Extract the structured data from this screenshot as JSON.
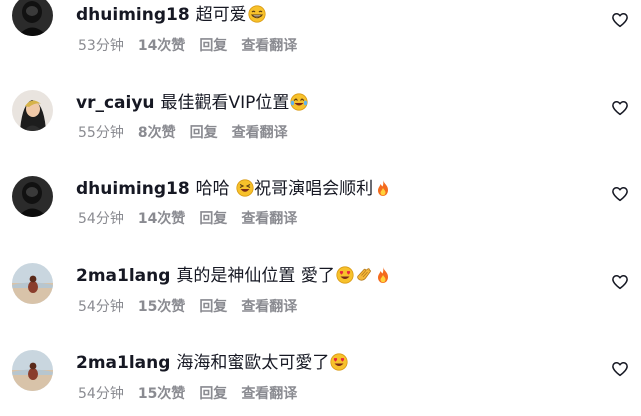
{
  "comments": [
    {
      "username": "dhuiming18",
      "text": "超可爱",
      "emojis": [
        "grin-emoji"
      ],
      "time": "53分钟",
      "likes": "14次赞",
      "reply": "回复",
      "translate": "查看翻译",
      "avatar": "dark-avatar"
    },
    {
      "username": "vr_caiyu",
      "text": "最佳觀看VIP位置",
      "emojis": [
        "laugh-tears-emoji"
      ],
      "time": "55分钟",
      "likes": "8次赞",
      "reply": "回复",
      "translate": "查看翻译",
      "avatar": "girl-avatar"
    },
    {
      "username": "dhuiming18",
      "text": "哈哈",
      "emojis": [
        "squint-laugh-emoji"
      ],
      "text2": "祝哥演唱会顺利",
      "emojis2": [
        "fire-emoji"
      ],
      "time": "54分钟",
      "likes": "14次赞",
      "reply": "回复",
      "translate": "查看翻译",
      "avatar": "dark-avatar"
    },
    {
      "username": "2ma1lang",
      "text": "真的是神仙位置 愛了",
      "emojis": [
        "heart-eyes-emoji",
        "clap-emoji",
        "fire-emoji"
      ],
      "time": "54分钟",
      "likes": "15次赞",
      "reply": "回复",
      "translate": "查看翻译",
      "avatar": "landscape-avatar"
    },
    {
      "username": "2ma1lang",
      "text": "海海和蜜歐太可愛了",
      "emojis": [
        "heart-eyes-emoji"
      ],
      "time": "54分钟",
      "likes": "15次赞",
      "reply": "回复",
      "translate": "查看翻译",
      "avatar": "landscape-avatar"
    }
  ],
  "colors": {
    "text": "#161823",
    "meta": "#8a8b91",
    "heart": "#161823"
  },
  "icons": {
    "like": "heart-outline-icon"
  }
}
